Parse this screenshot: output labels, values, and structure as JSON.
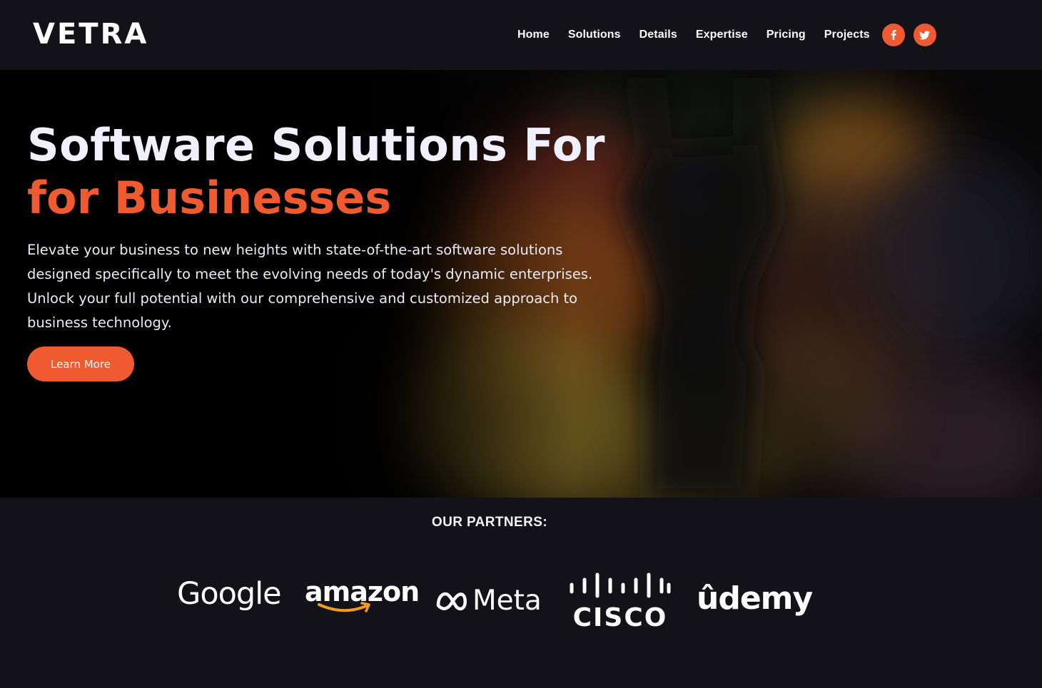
{
  "brand": {
    "logo": "VETRA"
  },
  "nav": {
    "items": [
      {
        "label": "Home"
      },
      {
        "label": "Solutions"
      },
      {
        "label": "Details"
      },
      {
        "label": "Expertise"
      },
      {
        "label": "Pricing"
      },
      {
        "label": "Projects"
      }
    ],
    "social": [
      {
        "icon": "facebook-icon"
      },
      {
        "icon": "twitter-icon"
      }
    ]
  },
  "hero": {
    "title": "Software Solutions For",
    "accent": "for Businesses",
    "description": "Elevate your business to new heights with state-of-the-art software solutions designed specifically to meet the evolving needs of today's dynamic enterprises. Unlock your full potential with our comprehensive and customized approach to business technology.",
    "cta_label": "Learn More"
  },
  "partners": {
    "title": "OUR PARTNERS:",
    "logos": [
      "Google",
      "amazon",
      "Meta",
      "CISCO",
      "ûdemy"
    ]
  },
  "colors": {
    "accent": "#f05a30",
    "background": "#131218",
    "hero_background": "#000000",
    "text": "#ffffff"
  }
}
